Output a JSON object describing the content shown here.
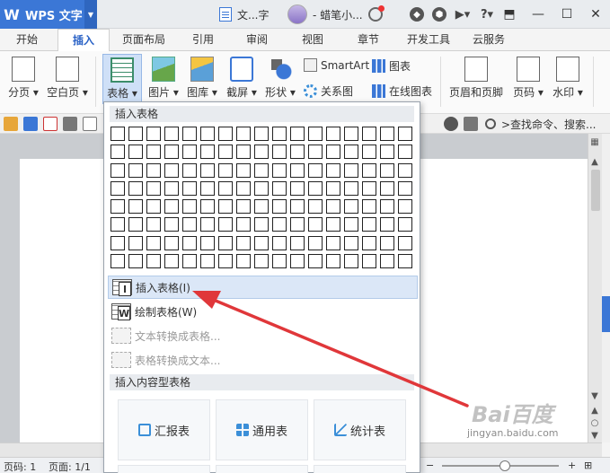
{
  "app": {
    "logo_text": "WPS 文字",
    "document_tab": "文...字",
    "user_name": "- 蜡笔小..."
  },
  "menu_tabs": [
    "开始",
    "插入",
    "页面布局",
    "引用",
    "审阅",
    "视图",
    "章节",
    "开发工具",
    "云服务"
  ],
  "active_tab": "插入",
  "ribbon": {
    "page_break": "分页",
    "blank_page": "空白页",
    "table": "表格",
    "picture": "图片",
    "gallery": "图库",
    "screenshot": "截屏",
    "shape": "形状",
    "smartart": "SmartArt",
    "chart": "图表",
    "relation_chart": "关系图",
    "online_chart": "在线图表",
    "header_footer": "页眉和页脚",
    "page_number": "页码",
    "watermark": "水印"
  },
  "search": {
    "placeholder": ">查找命令、搜索..."
  },
  "dropdown": {
    "header_insert_table": "插入表格",
    "grid_cols": 17,
    "grid_rows": 8,
    "items": [
      {
        "label": "插入表格(I)",
        "state": "hover"
      },
      {
        "label": "绘制表格(W)",
        "state": "enabled"
      },
      {
        "label": "文本转换成表格...",
        "state": "disabled"
      },
      {
        "label": "表格转换成文本...",
        "state": "disabled"
      }
    ],
    "header_content_table": "插入内容型表格",
    "cards": [
      "汇报表",
      "通用表",
      "统计表"
    ]
  },
  "status": {
    "page_number": "页码: 1",
    "pages": "页面: 1/1"
  },
  "watermark_site": "jingyan.baidu.com",
  "colors": {
    "accent": "#3b77d6",
    "arrow": "#e0373a"
  }
}
